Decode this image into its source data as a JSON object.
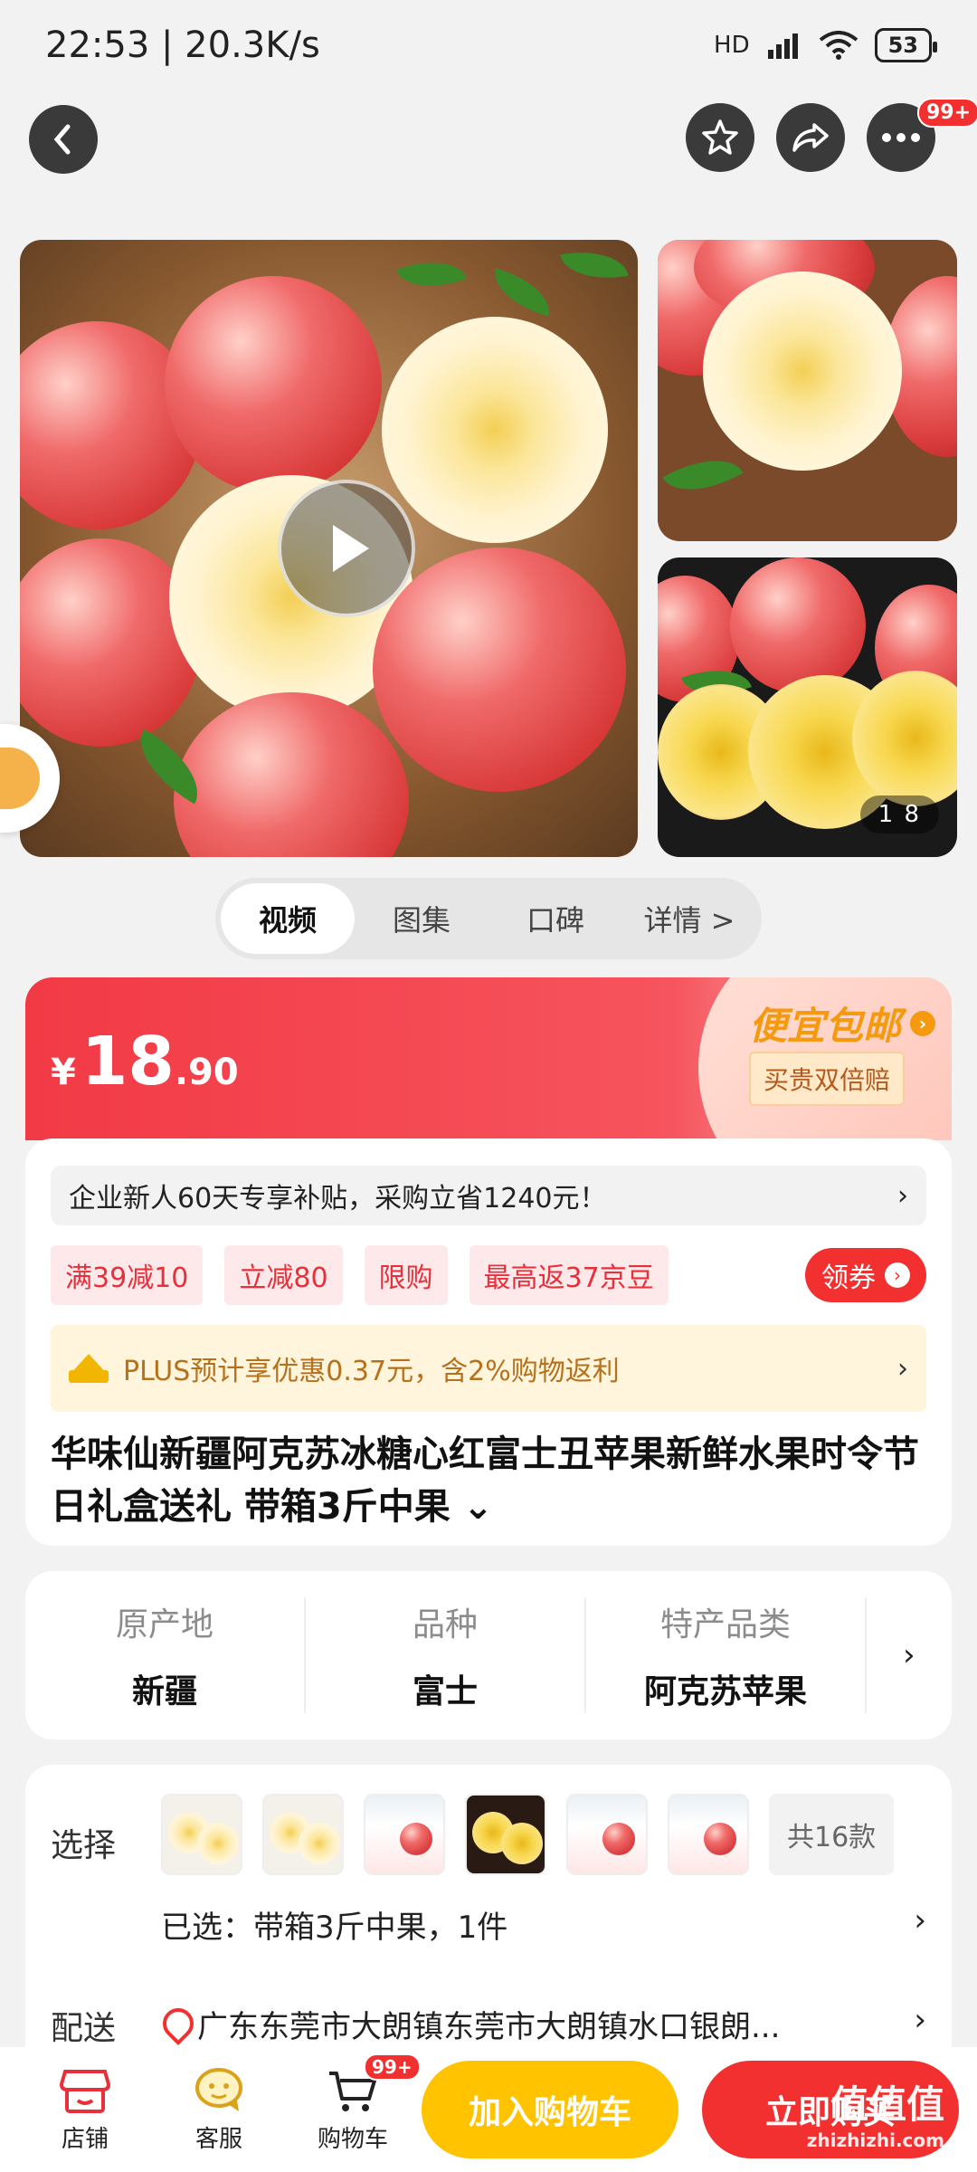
{
  "status_bar": {
    "time_speed": "22:53 | 20.3K/s",
    "network": "HD",
    "battery": "53"
  },
  "nav": {
    "back_icon": "chevron-left-icon",
    "more_badge": "99+"
  },
  "gallery": {
    "counter": "1 8"
  },
  "media_tabs": [
    "视频",
    "图集",
    "口碑",
    "详情 >"
  ],
  "price": {
    "currency": "¥",
    "integer": "18",
    "decimal": ".90",
    "promo_title": "便宜包邮",
    "promo_sub": "买贵双倍赔"
  },
  "info": {
    "subsidy": "企业新人60天专享补贴，采购立省1240元！",
    "chips": [
      "满39减10",
      "立减80",
      "限购",
      "最高返37京豆"
    ],
    "coupon": "领券",
    "plus": "PLUS预计享优惠0.37元，含2%购物返利",
    "title": "华味仙新疆阿克苏冰糖心红富士丑苹果新鲜水果时令节日礼盒送礼 带箱3斤中果 ⌄"
  },
  "attributes": [
    {
      "key": "原产地",
      "value": "新疆"
    },
    {
      "key": "品种",
      "value": "富士"
    },
    {
      "key": "特产品类",
      "value": "阿克苏苹果"
    }
  ],
  "selection": {
    "label": "选择",
    "more_styles": "共16款",
    "chosen": "已选：带箱3斤中果，1件",
    "delivery_label": "配送",
    "address": "广东东莞市大朗镇东莞市大朗镇水口银朗..."
  },
  "bottom_bar": {
    "store": "店铺",
    "service": "客服",
    "cart": "购物车",
    "cart_badge": "99+",
    "add_to_cart": "加入购物车",
    "buy_now": "立即购买"
  },
  "watermark": {
    "main": "值值值",
    "domain": "zhizhizhi.com"
  },
  "colors": {
    "accent_red": "#f23030",
    "cart_yellow": "#ffc300",
    "plus_gold": "#b5711b"
  }
}
